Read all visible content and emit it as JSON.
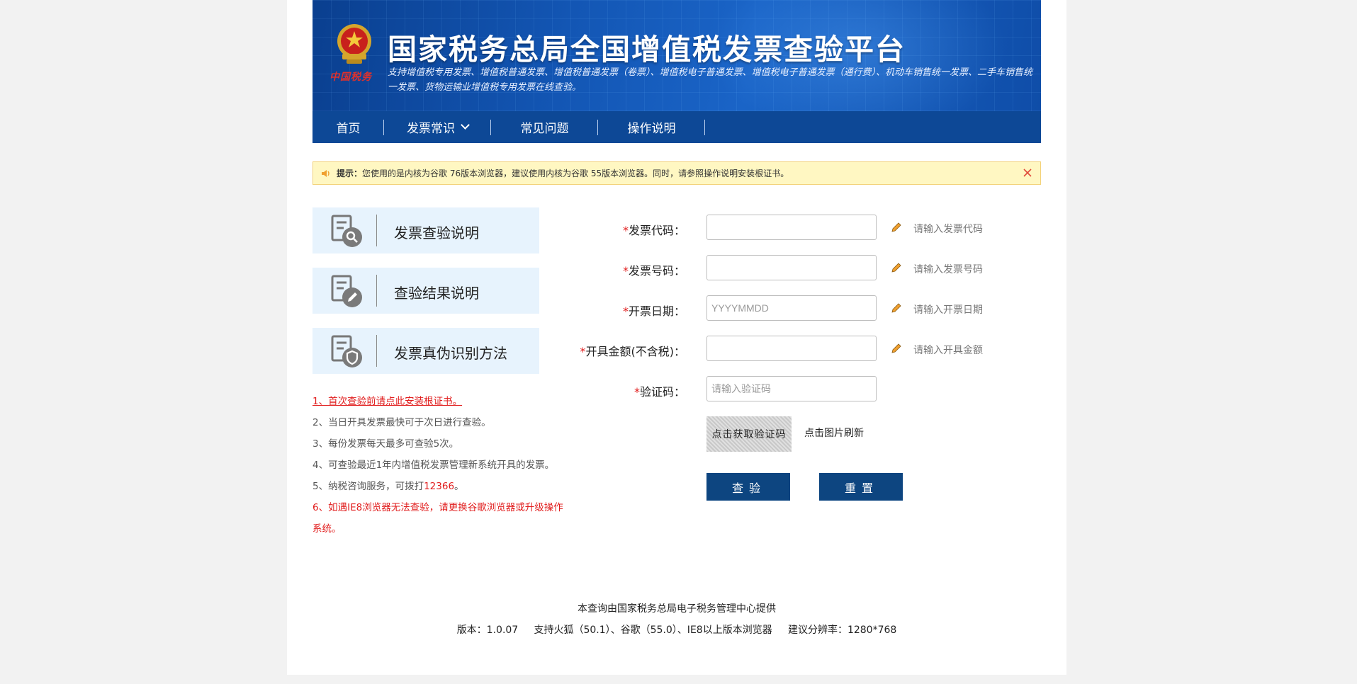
{
  "header": {
    "title": "国家税务总局全国增值税发票查验平台",
    "subtitle": "支持增值税专用发票、增值税普通发票、增值税普通发票（卷票）、增值税电子普通发票、增值税电子普通发票（通行费）、机动车销售统一发票、二手车销售统一发票、货物运输业增值税专用发票在线查验。",
    "emblem_caption": "中国税务"
  },
  "nav": {
    "items": [
      {
        "label": "首页"
      },
      {
        "label": "发票常识"
      },
      {
        "label": "常见问题"
      },
      {
        "label": "操作说明"
      }
    ]
  },
  "notice": {
    "prefix": "提示：",
    "text": "您使用的是内核为谷歌 76版本浏览器，建议使用内核为谷歌 55版本浏览器。同时，请参照操作说明安装根证书。"
  },
  "cards": [
    {
      "label": "发票查验说明"
    },
    {
      "label": "查验结果说明"
    },
    {
      "label": "发票真伪识别方法"
    }
  ],
  "tips": {
    "t1": "1、首次查验前请点此安装根证书。",
    "t2": "2、当日开具发票最快可于次日进行查验。",
    "t3": "3、每份发票每天最多可查验5次。",
    "t4": "4、可查验最近1年内增值税发票管理新系统开具的发票。",
    "t5_prefix": "5、纳税咨询服务，可拨打",
    "t5_phone": "12366",
    "t5_suffix": "。",
    "t6": "6、如遇IE8浏览器无法查验，请更换谷歌浏览器或升级操作系统。"
  },
  "form": {
    "required_mark": "*",
    "invoice_code": {
      "label": "发票代码：",
      "value": "",
      "placeholder": "",
      "hint": "请输入发票代码"
    },
    "invoice_number": {
      "label": "发票号码：",
      "value": "",
      "placeholder": "",
      "hint": "请输入发票号码"
    },
    "issue_date": {
      "label": "开票日期：",
      "value": "",
      "placeholder": "YYYYMMDD",
      "hint": "请输入开票日期"
    },
    "amount": {
      "label": "开具金额(不含税)：",
      "value": "",
      "placeholder": "",
      "hint": "请输入开具金额"
    },
    "captcha": {
      "label": "验证码：",
      "value": "",
      "placeholder": "请输入验证码"
    },
    "captcha_image_text": "点击获取验证码",
    "captcha_refresh": "点击图片刷新",
    "submit_label": "查验",
    "reset_label": "重置"
  },
  "footer": {
    "line1": "本查询由国家税务总局电子税务管理中心提供",
    "line2": "版本：1.0.07     支持火狐（50.1）、谷歌（55.0）、IE8以上版本浏览器     建议分辨率：1280*768"
  },
  "colors": {
    "banner": "#1356b4",
    "nav": "#0d4896",
    "button": "#0d4580",
    "required": "#e11d1d",
    "notice_bg": "#fff7c2"
  }
}
